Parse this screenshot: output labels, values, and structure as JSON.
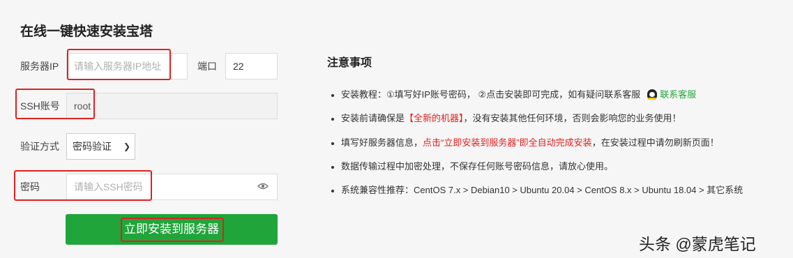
{
  "form": {
    "title": "在线一键快速安装宝塔",
    "server_ip": {
      "label": "服务器IP",
      "placeholder": "请输入服务器IP地址"
    },
    "port": {
      "label": "端口",
      "value": "22"
    },
    "ssh_account": {
      "label": "SSH账号",
      "value": "root"
    },
    "auth_method": {
      "label": "验证方式",
      "selected": "密码验证"
    },
    "password": {
      "label": "密码",
      "placeholder": "请输入SSH密码"
    },
    "install_button": "立即安装到服务器"
  },
  "notes": {
    "title": "注意事项",
    "item1_text": "安装教程：①填写好IP账号密码， ②点击安装即可完成，如有疑问联系客服",
    "item1_link": "联系客服",
    "item2_pre": "安装前请确保是",
    "item2_red": "【全新的机器】",
    "item2_post": "，没有安装其他任何环境，否则会影响您的业务使用！",
    "item3_pre": "填写好服务器信息，",
    "item3_red": "点击“立即安装到服务器”即全自动完成安装",
    "item3_post": "，在安装过程中请勿刷新页面！",
    "item4": "数据传输过程中加密处理，不保存任何账号密码信息，请放心使用。",
    "item5": "系统兼容性推荐：CentOS 7.x > Debian10 > Ubuntu 20.04 > CentOS 8.x > Ubuntu 18.04 > 其它系统"
  },
  "watermark": "头条 @蒙虎笔记",
  "colors": {
    "accent_green": "#20a53a",
    "highlight_red": "#e02020"
  }
}
